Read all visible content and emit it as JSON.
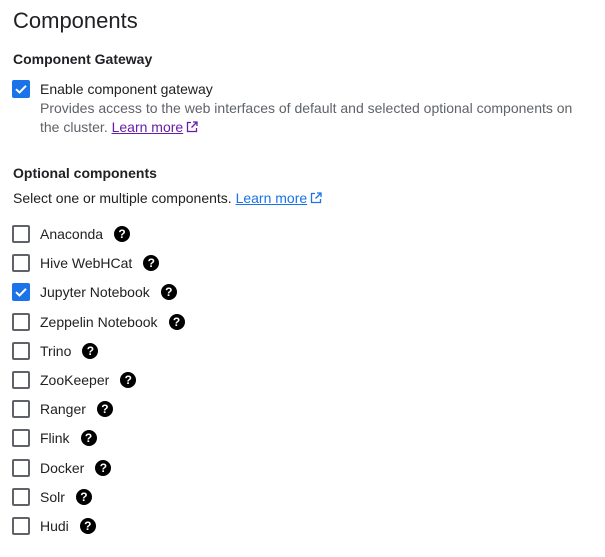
{
  "page": {
    "title": "Components"
  },
  "gateway": {
    "section_title": "Component Gateway",
    "checkbox_label": "Enable component gateway",
    "checked": true,
    "description": "Provides access to the web interfaces of default and selected optional components on the cluster.",
    "learn_more": "Learn more"
  },
  "optional": {
    "section_title": "Optional components",
    "intro": "Select one or multiple components.",
    "learn_more": "Learn more",
    "components": [
      {
        "label": "Anaconda",
        "checked": false
      },
      {
        "label": "Hive WebHCat",
        "checked": false
      },
      {
        "label": "Jupyter Notebook",
        "checked": true
      },
      {
        "label": "Zeppelin Notebook",
        "checked": false
      },
      {
        "label": "Trino",
        "checked": false
      },
      {
        "label": "ZooKeeper",
        "checked": false
      },
      {
        "label": "Ranger",
        "checked": false
      },
      {
        "label": "Flink",
        "checked": false
      },
      {
        "label": "Docker",
        "checked": false
      },
      {
        "label": "Solr",
        "checked": false
      },
      {
        "label": "Hudi",
        "checked": false
      }
    ]
  },
  "icons": {
    "help": "help-icon",
    "external_link": "open-in-new-icon",
    "check": "check-icon"
  },
  "colors": {
    "accent": "#1a73e8",
    "visited_link": "#681da8",
    "secondary_text": "#5f6368",
    "primary_text": "#202124"
  }
}
